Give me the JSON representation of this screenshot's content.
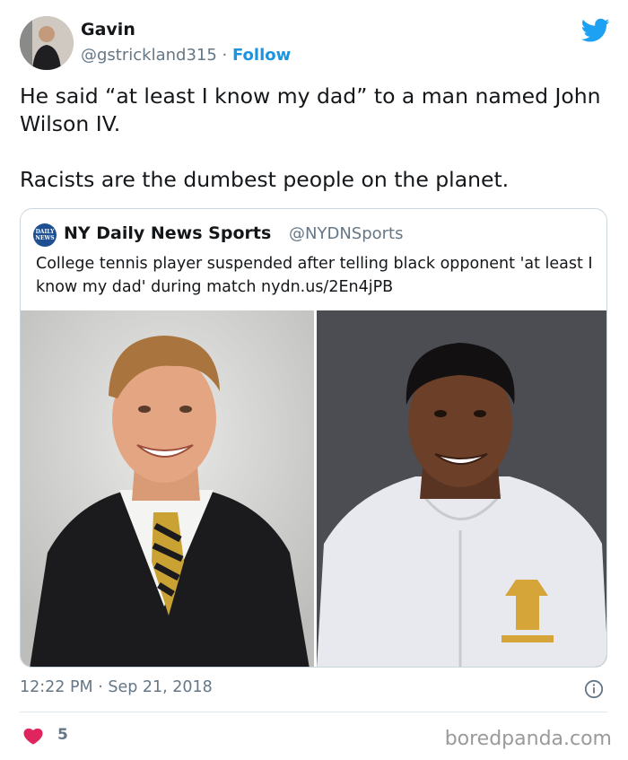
{
  "author": {
    "name": "Gavin",
    "handle": "@gstrickland315",
    "separator": " · ",
    "follow_label": "Follow"
  },
  "tweet": {
    "line1": "He said “at least I know my dad” to a man named John Wilson IV.",
    "line2": "Racists are the dumbest people on the planet."
  },
  "quoted": {
    "logo_text": [
      "DAILY",
      "NEWS"
    ],
    "name": "NY Daily News Sports",
    "handle": "@NYDNSports",
    "text": "College tennis player suspended after telling black opponent 'at least I know my dad' during match nydn.us/2En4jPB"
  },
  "meta": {
    "timestamp": "12:22 PM · Sep 21, 2018",
    "like_count": "5"
  },
  "watermark": "boredpanda.com",
  "colors": {
    "twitter_blue": "#1b95e0",
    "heart_red": "#e0245e",
    "secondary_text": "#657786",
    "border": "#ccd6dd"
  },
  "icons": [
    "twitter-bird-icon",
    "info-icon",
    "heart-icon"
  ]
}
